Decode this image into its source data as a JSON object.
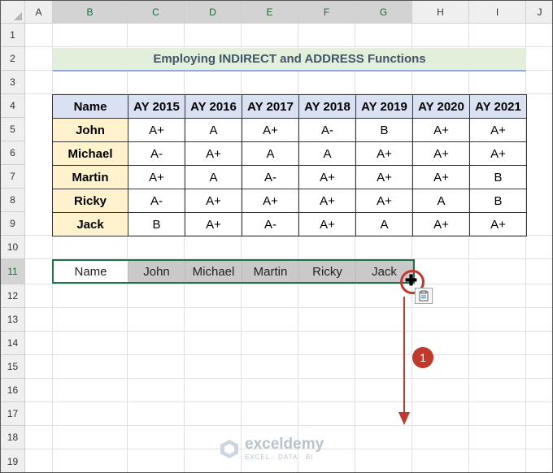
{
  "sheet": {
    "columns": [
      "A",
      "B",
      "C",
      "D",
      "E",
      "F",
      "G",
      "H",
      "I",
      "J"
    ],
    "rows": [
      "1",
      "2",
      "3",
      "4",
      "5",
      "6",
      "7",
      "8",
      "9",
      "10",
      "11",
      "12",
      "13",
      "14",
      "15",
      "16",
      "17",
      "18",
      "19"
    ],
    "selected_columns": [
      "B",
      "C",
      "D",
      "E",
      "F",
      "G"
    ],
    "selected_row": "11"
  },
  "title": "Employing INDIRECT and ADDRESS Functions",
  "table": {
    "header": [
      "Name",
      "AY 2015",
      "AY 2016",
      "AY 2017",
      "AY 2018",
      "AY 2019",
      "AY 2020",
      "AY 2021"
    ],
    "rows": [
      [
        "John",
        "A+",
        "A",
        "A+",
        "A-",
        "B",
        "A+",
        "A+"
      ],
      [
        "Michael",
        "A-",
        "A+",
        "A",
        "A",
        "A+",
        "A+",
        "A+"
      ],
      [
        "Martin",
        "A+",
        "A",
        "A-",
        "A+",
        "A+",
        "A+",
        "B"
      ],
      [
        "Ricky",
        "A-",
        "A+",
        "A+",
        "A+",
        "A+",
        "A",
        "B"
      ],
      [
        "Jack",
        "B",
        "A+",
        "A-",
        "A+",
        "A",
        "A+",
        "A+"
      ]
    ]
  },
  "transposed": {
    "label": "Name",
    "values": [
      "John",
      "Michael",
      "Martin",
      "Ricky",
      "Jack"
    ]
  },
  "annotation": {
    "step_badge": "1",
    "fill_handle_icon": "plus-cursor-icon",
    "paste_options_icon": "clipboard-icon"
  },
  "logo": {
    "brand": "exceldemy",
    "tagline": "EXCEL · DATA · BI"
  },
  "colors": {
    "title_bg": "#e2efda",
    "header_bg": "#d9e1f2",
    "name_bg": "#fff2cc",
    "selection_fill": "#c9c9c9",
    "selection_border": "#217346",
    "annotation_red": "#c0392b"
  }
}
